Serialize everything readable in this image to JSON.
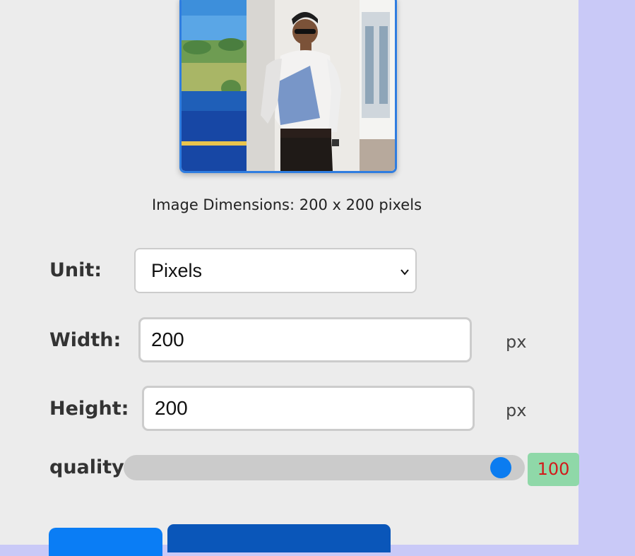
{
  "preview": {
    "image_name": "person-photo"
  },
  "dimensions_text": "Image Dimensions: 200 x 200 pixels",
  "form": {
    "unit_label": "Unit:",
    "unit_value": "Pixels",
    "width_label": "Width:",
    "width_value": "200",
    "width_unit": "px",
    "height_label": "Height:",
    "height_value": "200",
    "height_unit": "px",
    "quality_label": "quality:",
    "quality_value": "100",
    "quality_fraction": 0.94
  },
  "colors": {
    "accent": "#0b7cf0",
    "panel_bg": "#ececec",
    "side_bg": "#c9c9f7",
    "quality_badge_bg": "#8fd8a8",
    "quality_badge_text": "#d21a1a",
    "primary_button": "#0a7df5",
    "secondary_button": "#0a56b9"
  },
  "icons": {
    "select_chevron": "chevron-down-icon"
  }
}
